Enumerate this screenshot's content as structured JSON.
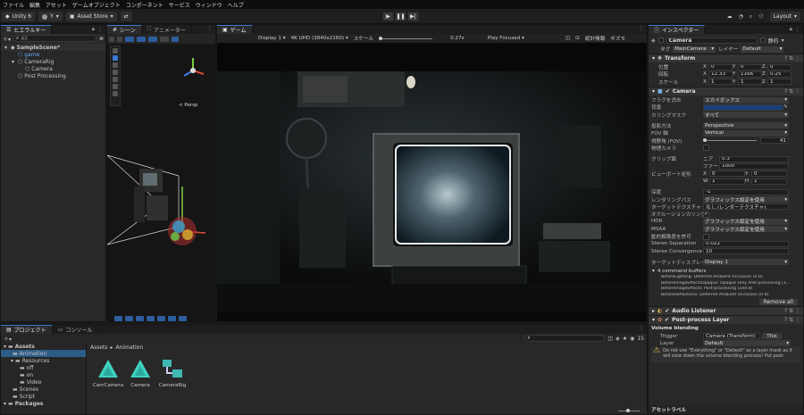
{
  "menu": [
    "ファイル",
    "編集",
    "アセット",
    "ゲームオブジェクト",
    "コンポーネント",
    "サービス",
    "ウィンドウ",
    "ヘルプ"
  ],
  "toolbar": {
    "unity": "Unity 6",
    "account": "Y",
    "store": "Asset Store",
    "layout": "Layout"
  },
  "hierarchy": {
    "tab": "ヒエラルキー",
    "search": "All",
    "items": [
      {
        "label": "SampleScene*",
        "indent": 0,
        "kind": "scene"
      },
      {
        "label": "game",
        "indent": 1,
        "kind": "blue"
      },
      {
        "label": "CameraRig",
        "indent": 1,
        "kind": "go"
      },
      {
        "label": "Camera",
        "indent": 2,
        "kind": "go"
      },
      {
        "label": "Post Processing",
        "indent": 1,
        "kind": "go"
      }
    ]
  },
  "scene": {
    "tab": "シーン",
    "anim_tab": "アニメーター",
    "persp": "< Persp"
  },
  "game": {
    "tab": "ゲーム",
    "display": "Display 1",
    "resolution": "4K UHD (3840x2160)",
    "scale_label": "スケール",
    "scale": "0.27x",
    "play_mode": "Play Focused",
    "stats": "統計情報",
    "gizmos": "ギズモ"
  },
  "inspector": {
    "tab": "インスペクター",
    "object": "Camera",
    "static": "静的",
    "tag_label": "タグ",
    "tag": "MainCamera",
    "layer_label": "レイヤー",
    "layer": "Default",
    "transform": {
      "title": "Transform",
      "pos": "位置",
      "rot": "回転",
      "scl": "スケール",
      "px": "0",
      "py": "0",
      "pz": "0",
      "rx": "12.33",
      "ry": "1166",
      "rz": "0.25",
      "sx": "1",
      "sy": "1",
      "sz": "1"
    },
    "camera": {
      "title": "Camera",
      "rows": [
        {
          "label": "フラグを消去",
          "type": "dd",
          "value": "スカイボックス"
        },
        {
          "label": "背景",
          "type": "color",
          "value": ""
        },
        {
          "label": "カリングマスク",
          "type": "dd",
          "value": "すべて"
        },
        {
          "label": "",
          "type": "gap",
          "value": ""
        },
        {
          "label": "投影方法",
          "type": "dd",
          "value": "Perspective"
        },
        {
          "label": "FOV 軸",
          "type": "dd",
          "value": "Vertical"
        },
        {
          "label": "視野角 (FOV)",
          "type": "slider",
          "value": "41"
        },
        {
          "label": "物理カメラ",
          "type": "check",
          "value": ""
        },
        {
          "label": "",
          "type": "gap",
          "value": ""
        },
        {
          "label": "クリップ面",
          "type": "clip1",
          "value": "0.3",
          "sub": "ニア"
        },
        {
          "label": "",
          "type": "clip2",
          "value": "1000",
          "sub": "ファー"
        },
        {
          "label": "ビューポート矩形",
          "type": "xy",
          "x": "0",
          "y": "0"
        },
        {
          "label": "",
          "type": "wh",
          "x": "1",
          "y": "1"
        },
        {
          "label": "",
          "type": "gap",
          "value": ""
        },
        {
          "label": "深度",
          "type": "fld",
          "value": "-1"
        },
        {
          "label": "レンダリングパス",
          "type": "dd",
          "value": "グラフィックス設定を使用"
        },
        {
          "label": "ターゲットテクスチャ",
          "type": "fld",
          "value": "なし (レンダーテクスチャ)"
        },
        {
          "label": "オクルージョンカリング",
          "type": "checked",
          "value": ""
        },
        {
          "label": "HDR",
          "type": "dd",
          "value": "グラフィックス設定を使用"
        },
        {
          "label": "MSAA",
          "type": "dd",
          "value": "グラフィックス設定を使用"
        },
        {
          "label": "動的解像度を許可",
          "type": "check",
          "value": ""
        },
        {
          "label": "Stereo Separation",
          "type": "fld",
          "value": "0.022"
        },
        {
          "label": "Stereo Convergence",
          "type": "fld",
          "value": "10"
        },
        {
          "label": "",
          "type": "gap",
          "value": ""
        },
        {
          "label": "ターゲットディスプレイ",
          "type": "dd",
          "value": "Display 1"
        }
      ],
      "buffers_title": "4 command buffers",
      "buffers": [
        "BeforeLighting: Deferred Ambient Occlusion (0 B)",
        "BeforeImageEffectsOpaque: Opaque Only Post-processing (3...",
        "BeforeImageEffects: Post-processing (344 B)",
        "BeforeReflections: Deferred Ambient Occlusion (0 B)"
      ],
      "remove_all": "Remove all"
    },
    "audio_listener": "Audio Listener",
    "post_layer": {
      "title": "Post-process Layer",
      "volume_blending": "Volume blending",
      "trigger_label": "Trigger",
      "trigger": "Camera (Transform)",
      "this_btn": "This",
      "layer_label": "Layer",
      "layer": "Default",
      "warning": "Do not use \"Everything\" or \"Default\" as a layer mask as it will slow down the volume blending process! Put post-"
    },
    "asset_label": "アセットラベル"
  },
  "project": {
    "tab": "プロジェクト",
    "console_tab": "コンソール",
    "breadcrumb_root": "Assets",
    "breadcrumb_leaf": "Animation",
    "count": "15",
    "tree": [
      {
        "label": "Assets",
        "indent": 0,
        "bold": true
      },
      {
        "label": "Animation",
        "indent": 1,
        "sel": true
      },
      {
        "label": "Resources",
        "indent": 1
      },
      {
        "label": "off",
        "indent": 2
      },
      {
        "label": "on",
        "indent": 2
      },
      {
        "label": "Video",
        "indent": 2
      },
      {
        "label": "Scenes",
        "indent": 1
      },
      {
        "label": "Script",
        "indent": 1
      },
      {
        "label": "Packages",
        "indent": 0,
        "bold": true
      }
    ],
    "assets": [
      {
        "name": "CamCamera",
        "kind": "anim"
      },
      {
        "name": "Camera",
        "kind": "anim"
      },
      {
        "name": "CameraRig",
        "kind": "ctrl"
      }
    ]
  }
}
